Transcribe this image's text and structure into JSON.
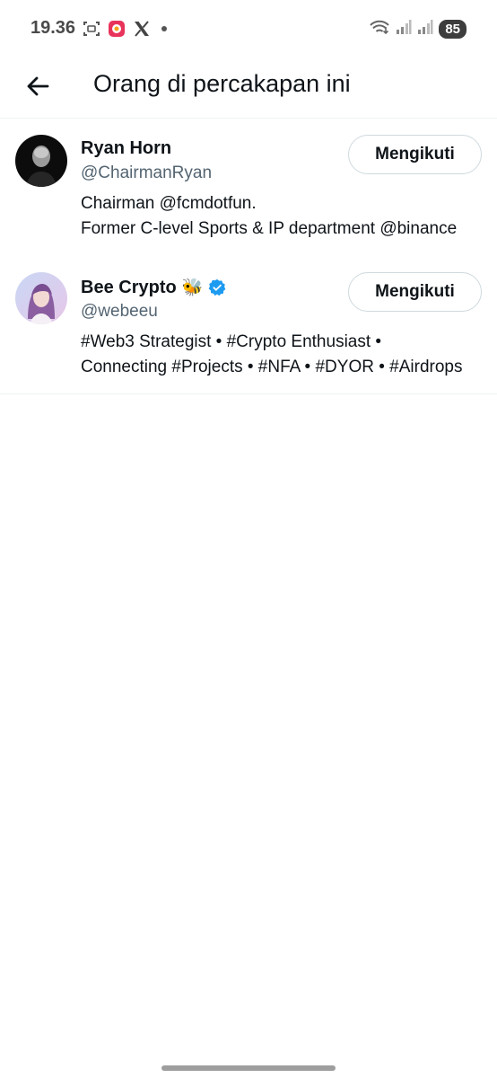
{
  "status_bar": {
    "time": "19.36",
    "battery": "85",
    "icons": [
      "screenshot-icon",
      "app-notification-icon",
      "x-logo-icon",
      "dot-icon",
      "wifi-icon",
      "signal-icon",
      "signal-icon-2",
      "battery-icon"
    ]
  },
  "header": {
    "title": "Orang di percakapan ini",
    "back_icon": "arrow-left-icon"
  },
  "users": [
    {
      "name": "Ryan Horn",
      "handle": "@ChairmanRyan",
      "bio_line1": "Chairman @fcmdotfun.",
      "bio_line2": "Former C-level Sports & IP department @binance",
      "follow_label": "Mengikuti",
      "verified": false
    },
    {
      "name": "Bee Crypto",
      "name_emoji": "🐝",
      "handle": "@webeeu",
      "bio_line1": "#Web3 Strategist • #Crypto Enthusiast •",
      "bio_line2": "Connecting #Projects • #NFA •  #DYOR • #Airdrops",
      "follow_label": "Mengikuti",
      "verified": true
    }
  ],
  "colors": {
    "text_primary": "#0f1419",
    "text_secondary": "#536471",
    "verified_blue": "#1d9bf0",
    "border": "#cfd9de"
  }
}
